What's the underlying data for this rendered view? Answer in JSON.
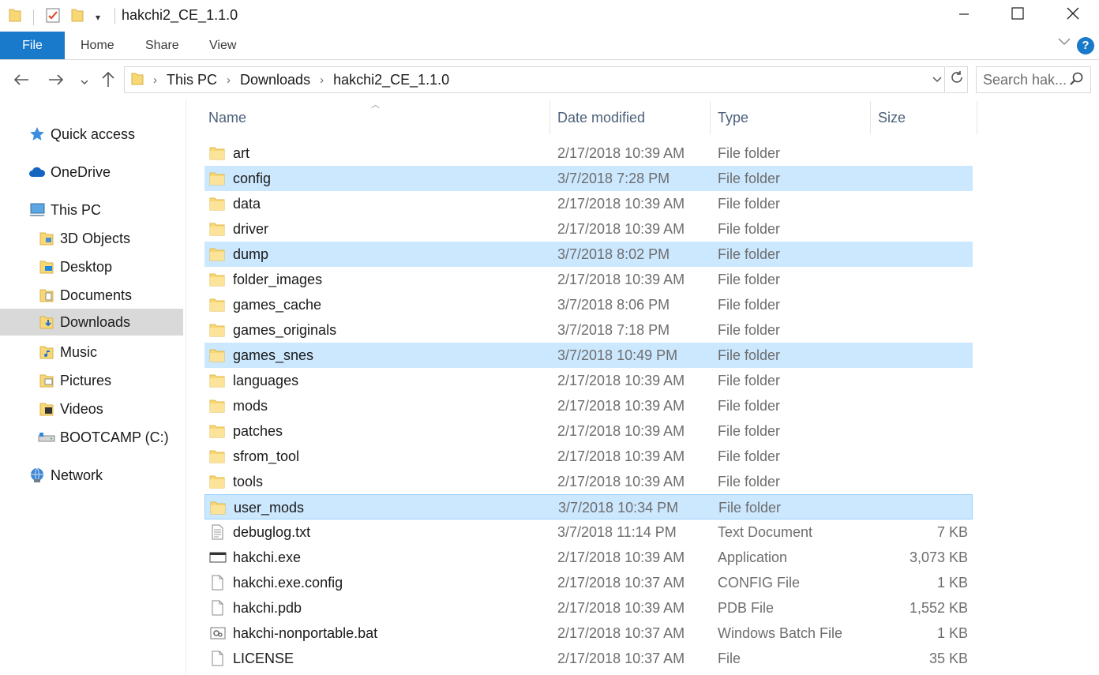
{
  "window": {
    "title": "hakchi2_CE_1.1.0",
    "minimize_icon": "minimize-icon",
    "maximize_icon": "maximize-icon",
    "close_icon": "close-icon"
  },
  "ribbon": {
    "tabs": [
      "File",
      "Home",
      "Share",
      "View"
    ]
  },
  "address": {
    "crumbs": [
      "This PC",
      "Downloads",
      "hakchi2_CE_1.1.0"
    ]
  },
  "search": {
    "placeholder": "Search hak..."
  },
  "nav": {
    "items": [
      {
        "label": "Quick access",
        "icon": "star-icon"
      },
      {
        "label": "OneDrive",
        "icon": "cloud-icon"
      },
      {
        "label": "This PC",
        "icon": "computer-icon"
      },
      {
        "label": "3D Objects",
        "icon": "folder-icon"
      },
      {
        "label": "Desktop",
        "icon": "folder-icon"
      },
      {
        "label": "Documents",
        "icon": "folder-icon"
      },
      {
        "label": "Downloads",
        "icon": "download-folder-icon"
      },
      {
        "label": "Music",
        "icon": "folder-icon"
      },
      {
        "label": "Pictures",
        "icon": "folder-icon"
      },
      {
        "label": "Videos",
        "icon": "folder-icon"
      },
      {
        "label": "BOOTCAMP (C:)",
        "icon": "drive-icon"
      },
      {
        "label": "Network",
        "icon": "network-icon"
      }
    ]
  },
  "columns": [
    "Name",
    "Date modified",
    "Type",
    "Size"
  ],
  "files": [
    {
      "name": "art",
      "date": "2/17/2018 10:39 AM",
      "type": "File folder",
      "size": "",
      "kind": "folder"
    },
    {
      "name": "config",
      "date": "3/7/2018 7:28 PM",
      "type": "File folder",
      "size": "",
      "kind": "folder"
    },
    {
      "name": "data",
      "date": "2/17/2018 10:39 AM",
      "type": "File folder",
      "size": "",
      "kind": "folder"
    },
    {
      "name": "driver",
      "date": "2/17/2018 10:39 AM",
      "type": "File folder",
      "size": "",
      "kind": "folder"
    },
    {
      "name": "dump",
      "date": "3/7/2018 8:02 PM",
      "type": "File folder",
      "size": "",
      "kind": "folder"
    },
    {
      "name": "folder_images",
      "date": "2/17/2018 10:39 AM",
      "type": "File folder",
      "size": "",
      "kind": "folder"
    },
    {
      "name": "games_cache",
      "date": "3/7/2018 8:06 PM",
      "type": "File folder",
      "size": "",
      "kind": "folder"
    },
    {
      "name": "games_originals",
      "date": "3/7/2018 7:18 PM",
      "type": "File folder",
      "size": "",
      "kind": "folder"
    },
    {
      "name": "games_snes",
      "date": "3/7/2018 10:49 PM",
      "type": "File folder",
      "size": "",
      "kind": "folder"
    },
    {
      "name": "languages",
      "date": "2/17/2018 10:39 AM",
      "type": "File folder",
      "size": "",
      "kind": "folder"
    },
    {
      "name": "mods",
      "date": "2/17/2018 10:39 AM",
      "type": "File folder",
      "size": "",
      "kind": "folder"
    },
    {
      "name": "patches",
      "date": "2/17/2018 10:39 AM",
      "type": "File folder",
      "size": "",
      "kind": "folder"
    },
    {
      "name": "sfrom_tool",
      "date": "2/17/2018 10:39 AM",
      "type": "File folder",
      "size": "",
      "kind": "folder"
    },
    {
      "name": "tools",
      "date": "2/17/2018 10:39 AM",
      "type": "File folder",
      "size": "",
      "kind": "folder"
    },
    {
      "name": "user_mods",
      "date": "3/7/2018 10:34 PM",
      "type": "File folder",
      "size": "",
      "kind": "folder"
    },
    {
      "name": "debuglog.txt",
      "date": "3/7/2018 11:14 PM",
      "type": "Text Document",
      "size": "7 KB",
      "kind": "text"
    },
    {
      "name": "hakchi.exe",
      "date": "2/17/2018 10:39 AM",
      "type": "Application",
      "size": "3,073 KB",
      "kind": "exe"
    },
    {
      "name": "hakchi.exe.config",
      "date": "2/17/2018 10:37 AM",
      "type": "CONFIG File",
      "size": "1 KB",
      "kind": "blank"
    },
    {
      "name": "hakchi.pdb",
      "date": "2/17/2018 10:39 AM",
      "type": "PDB File",
      "size": "1,552 KB",
      "kind": "blank"
    },
    {
      "name": "hakchi-nonportable.bat",
      "date": "2/17/2018 10:37 AM",
      "type": "Windows Batch File",
      "size": "1 KB",
      "kind": "bat"
    },
    {
      "name": "LICENSE",
      "date": "2/17/2018 10:37 AM",
      "type": "File",
      "size": "35 KB",
      "kind": "blank"
    }
  ],
  "colors": {
    "accent": "#1979ca",
    "selection": "#cce8ff",
    "selection_border": "#99d1ff",
    "folder": "#f8d775",
    "nav_selected": "#d9d9d9"
  }
}
